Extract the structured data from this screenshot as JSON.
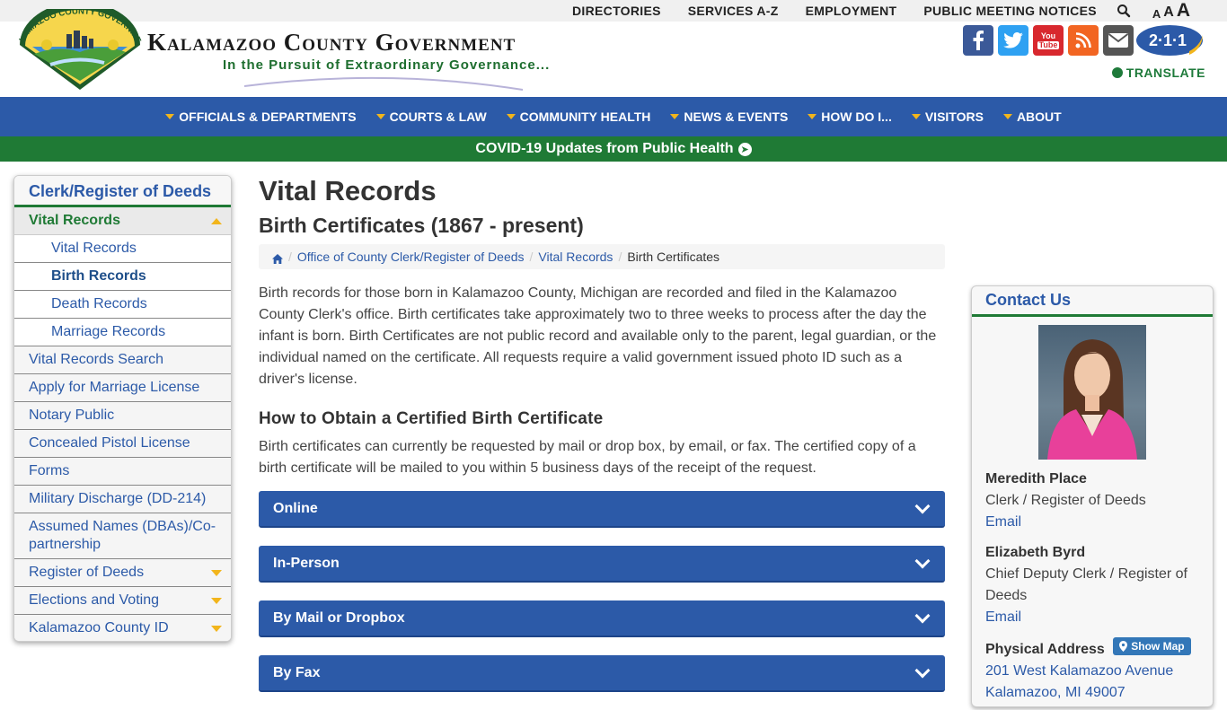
{
  "util": {
    "links": [
      "DIRECTORIES",
      "SERVICES A-Z",
      "EMPLOYMENT",
      "PUBLIC MEETING NOTICES"
    ],
    "size_small": "A",
    "size_medium": "A",
    "size_large": "A"
  },
  "header": {
    "logo_text": "KALAMAZOO COUNTY GOVERNMENT",
    "title": "Kalamazoo County Government",
    "tagline": "In the Pursuit of Extraordinary Governance...",
    "badge": "2·1·1",
    "translate": "TRANSLATE",
    "social": [
      {
        "name": "facebook-icon",
        "glyph": "f",
        "color": "#3b5998"
      },
      {
        "name": "twitter-icon",
        "glyph": "t",
        "color": "#2ea1f2"
      },
      {
        "name": "youtube-icon",
        "glyph": "You Tube",
        "color": "#d8282e"
      },
      {
        "name": "rss-icon",
        "glyph": "rss",
        "color": "#f26522"
      },
      {
        "name": "email-icon",
        "glyph": "mail",
        "color": "#555555"
      }
    ]
  },
  "nav": {
    "items": [
      "OFFICIALS & DEPARTMENTS",
      "COURTS & LAW",
      "COMMUNITY HEALTH",
      "NEWS & EVENTS",
      "HOW DO I...",
      "VISITORS",
      "ABOUT"
    ]
  },
  "covid": {
    "text": "COVID-19 Updates from Public Health"
  },
  "sidebar": {
    "title": "Clerk/Register of Deeds",
    "active": "Vital Records",
    "sub": [
      "Vital Records",
      "Birth Records",
      "Death Records",
      "Marriage Records"
    ],
    "items": [
      "Vital Records Search",
      "Apply for Marriage License",
      "Notary Public",
      "Concealed Pistol License",
      "Forms",
      "Military Discharge (DD-214)",
      "Assumed Names (DBAs)/Co-partnership"
    ],
    "expandable": [
      "Register of Deeds",
      "Elections and Voting",
      "Kalamazoo County ID"
    ]
  },
  "main": {
    "title": "Vital Records",
    "subtitle": "Birth Certificates (1867 - present)",
    "breadcrumb": [
      "Office of County Clerk/Register of Deeds",
      "Vital Records",
      "Birth Certificates"
    ],
    "intro": "Birth records for those born in Kalamazoo County, Michigan are recorded and filed in the Kalamazoo County Clerk's office. Birth certificates take approximately two to three weeks to process after the day the infant is born. Birth Certificates are not public record and available only to the parent, legal guardian, or the individual named on the certificate. All requests require a valid government issued photo ID such as a driver's license.",
    "heading": "How to Obtain a Certified Birth Certificate",
    "howto": "Birth certificates can currently be requested by mail or drop box, by email, or fax. The certified copy of a birth certificate will be mailed to you within 5 business days of the receipt of the request.",
    "accordion": [
      "Online",
      "In-Person",
      "By Mail or Dropbox",
      "By Fax"
    ]
  },
  "contact": {
    "title": "Contact Us",
    "person1_name": "Meredith Place",
    "person1_role": "Clerk / Register of Deeds",
    "person1_email": "Email",
    "person2_name": "Elizabeth Byrd",
    "person2_role": "Chief Deputy Clerk / Register of Deeds",
    "person2_email": "Email",
    "address_label": "Physical Address",
    "show_map": "Show Map",
    "address_line1": "201 West Kalamazoo Avenue",
    "address_line2": "Kalamazoo, MI 49007"
  }
}
